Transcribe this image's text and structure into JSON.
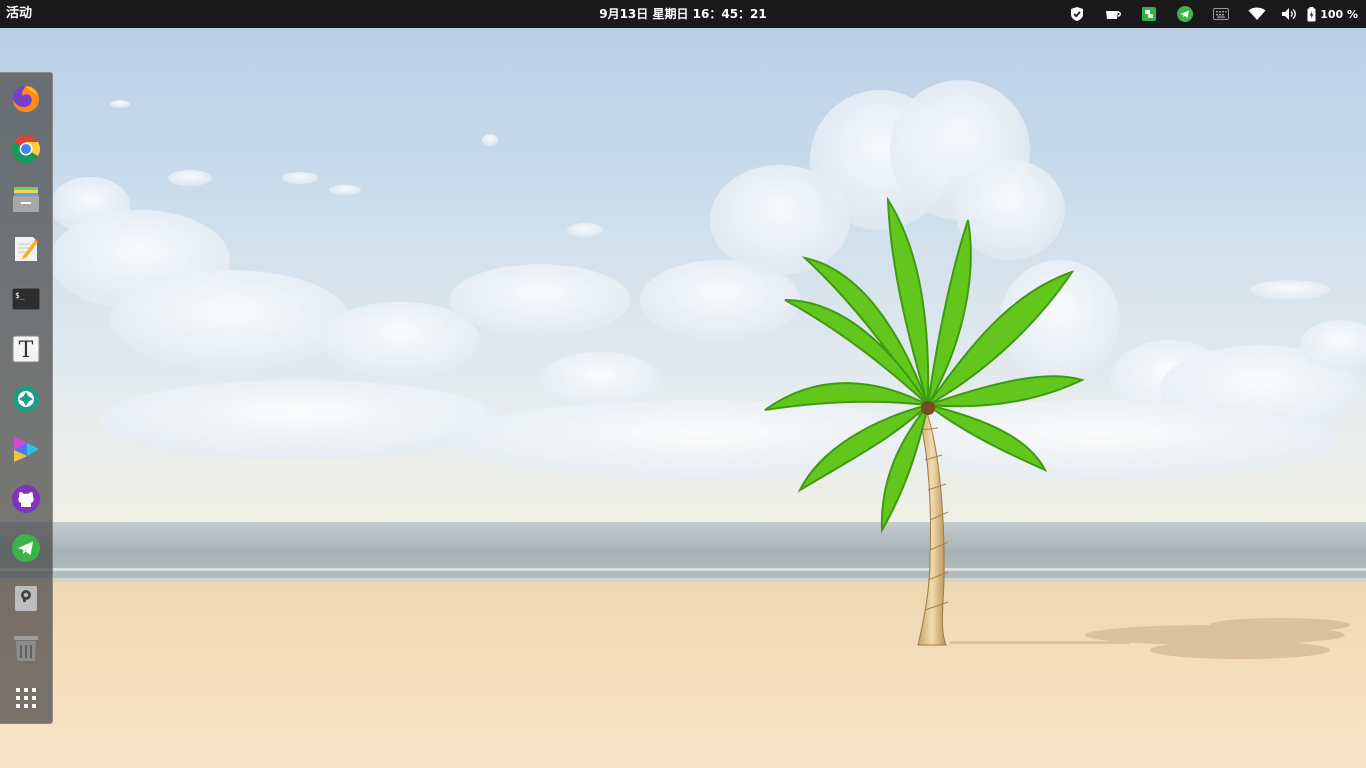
{
  "topbar": {
    "activities": "活动",
    "clock": "9月13日 星期日 16：45：21",
    "tray_icons": [
      "shield-icon",
      "cup-icon",
      "wechat-icon",
      "telegram-icon",
      "keyboard-icon",
      "wifi-icon",
      "volume-icon"
    ],
    "battery_percent": "100 %"
  },
  "dock": {
    "apps": [
      {
        "name": "firefox",
        "icon": "firefox-icon"
      },
      {
        "name": "chrome",
        "icon": "chrome-icon"
      },
      {
        "name": "files",
        "icon": "files-icon"
      },
      {
        "name": "text-editor",
        "icon": "text-editor-icon"
      },
      {
        "name": "terminal",
        "icon": "terminal-icon",
        "label": "$_"
      },
      {
        "name": "fonts",
        "icon": "fonts-icon",
        "label": "T"
      },
      {
        "name": "screenshot",
        "icon": "camera-aperture-icon"
      },
      {
        "name": "video-player",
        "icon": "video-player-icon"
      },
      {
        "name": "github-desktop",
        "icon": "github-icon"
      },
      {
        "name": "telegram",
        "icon": "telegram-icon"
      },
      {
        "name": "usb-drive",
        "icon": "usb-drive-icon"
      },
      {
        "name": "trash",
        "icon": "trash-icon"
      },
      {
        "name": "show-applications",
        "icon": "app-grid-icon"
      }
    ]
  },
  "colors": {
    "topbar_bg": "#1a1a1a",
    "dock_bg": "#464646",
    "sand": "#f2dcb8",
    "sea": "#a9b6b8",
    "sky_top": "#bccfe4",
    "palm_leaf": "#5bc21a"
  }
}
